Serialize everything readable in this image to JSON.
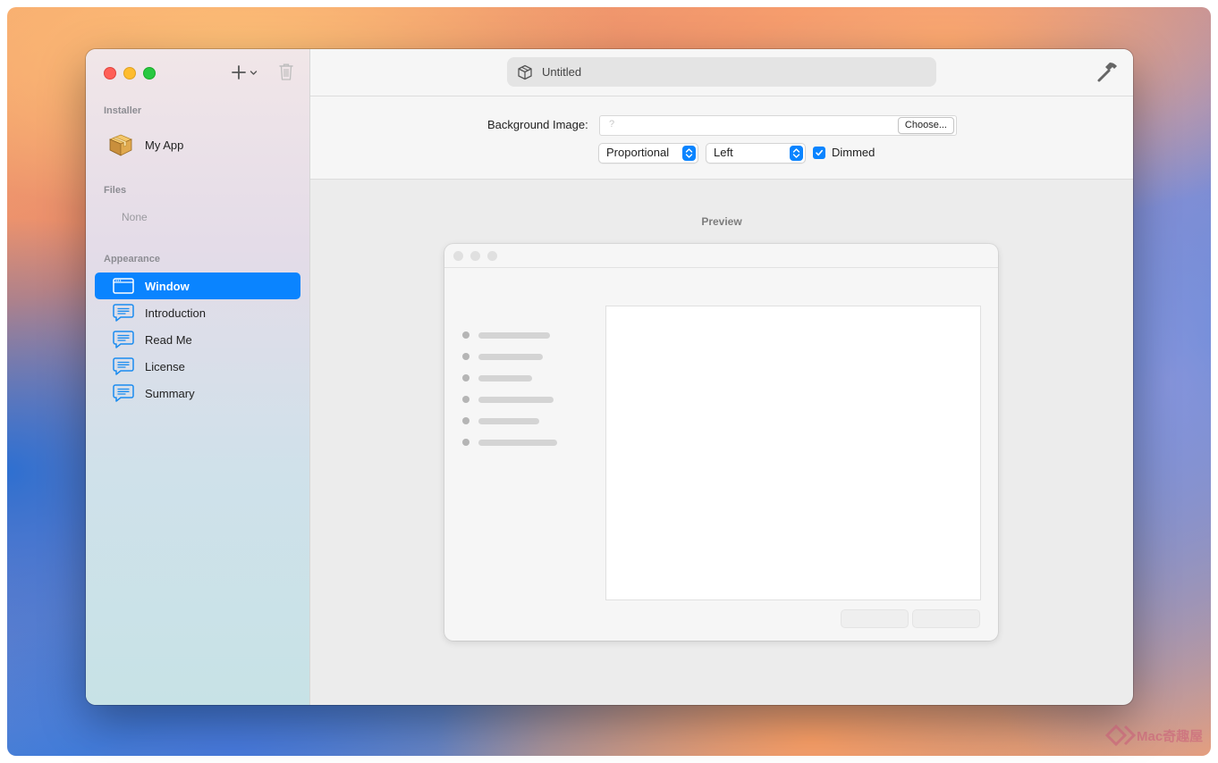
{
  "window": {
    "document_title": "Untitled"
  },
  "sidebar": {
    "sections": {
      "installer": "Installer",
      "files": "Files",
      "appearance": "Appearance"
    },
    "installer_item": {
      "label": "My App",
      "icon": "package-icon"
    },
    "files_empty": "None",
    "appearance_items": [
      {
        "label": "Window",
        "icon": "window-icon",
        "selected": true
      },
      {
        "label": "Introduction",
        "icon": "speech-bubble-icon",
        "selected": false
      },
      {
        "label": "Read Me",
        "icon": "speech-bubble-icon",
        "selected": false
      },
      {
        "label": "License",
        "icon": "speech-bubble-icon",
        "selected": false
      },
      {
        "label": "Summary",
        "icon": "speech-bubble-icon",
        "selected": false
      }
    ]
  },
  "settings": {
    "background_image_label": "Background Image:",
    "image_placeholder": "?",
    "choose_button": "Choose...",
    "scaling_value": "Proportional",
    "alignment_value": "Left",
    "dimmed_label": "Dimmed",
    "dimmed_checked": true
  },
  "preview": {
    "label": "Preview",
    "step_bar_lengths": [
      0.8,
      0.72,
      0.6,
      0.84,
      0.68,
      0.88
    ]
  },
  "watermark": "Mac奇趣屋",
  "colors": {
    "accent": "#0a84ff",
    "close": "#ff5f57",
    "minimize": "#febc2e",
    "maximize": "#28c840"
  }
}
